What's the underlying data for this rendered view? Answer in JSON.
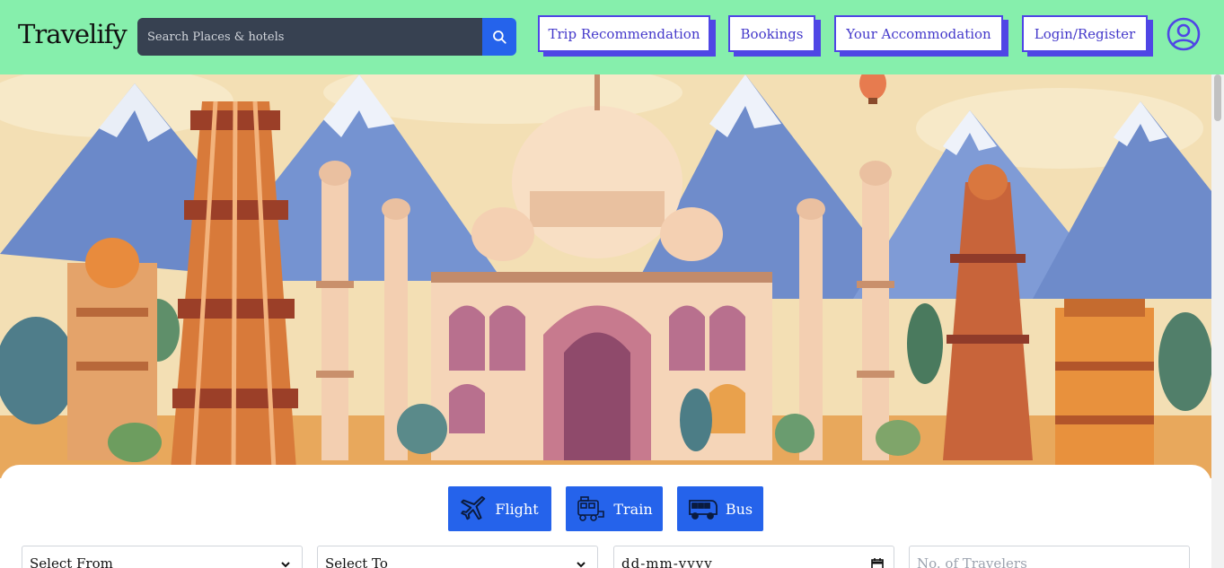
{
  "header": {
    "logo": "Travelify",
    "search": {
      "placeholder": "Search Places & hotels"
    },
    "nav": [
      "Trip Recommendation",
      "Bookings",
      "Your Accommodation",
      "Login/Register"
    ],
    "icons": {
      "search": "search-icon",
      "account": "user-circle-icon"
    },
    "colors": {
      "background": "#86efac",
      "accent": "#4f46e5",
      "search_bg": "#374151",
      "search_button": "#2563eb"
    }
  },
  "hero": {
    "image": "illustration of Indian landmarks (Taj Mahal, Qutub Minar) with mountains"
  },
  "booking": {
    "modes": [
      {
        "label": "Flight",
        "icon": "airplane-icon"
      },
      {
        "label": "Train",
        "icon": "train-icon"
      },
      {
        "label": "Bus",
        "icon": "bus-icon"
      }
    ],
    "fields": {
      "from": "Select From",
      "to": "Select To",
      "date": "dd-mm-yyyy",
      "travelers": "No. of Travelers"
    },
    "colors": {
      "mode_button": "#2563eb"
    }
  }
}
